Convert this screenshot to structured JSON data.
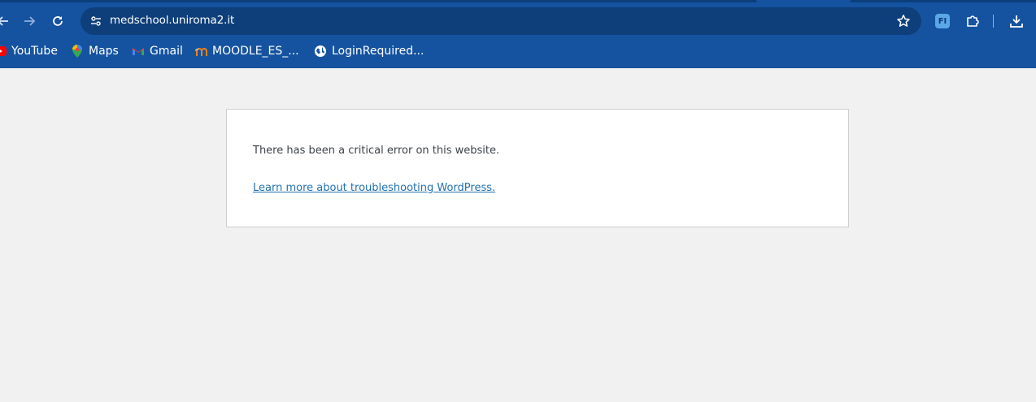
{
  "browser": {
    "url": "medschool.uniroma2.it",
    "bookmarks": [
      {
        "label": "YouTube",
        "icon": "youtube-icon"
      },
      {
        "label": "Maps",
        "icon": "maps-icon"
      },
      {
        "label": "Gmail",
        "icon": "gmail-icon"
      },
      {
        "label": "MOODLE_ES_...",
        "icon": "moodle-icon"
      },
      {
        "label": "LoginRequired...",
        "icon": "globe-icon"
      }
    ],
    "extension_badge": "FI",
    "colors": {
      "toolbar": "#1553a0",
      "omnibox": "#0e3f7a"
    }
  },
  "page": {
    "error_message": "There has been a critical error on this website.",
    "help_link": "Learn more about troubleshooting WordPress.",
    "colors": {
      "background": "#f1f1f1",
      "link": "#2271b1",
      "text": "#3c434a"
    }
  }
}
